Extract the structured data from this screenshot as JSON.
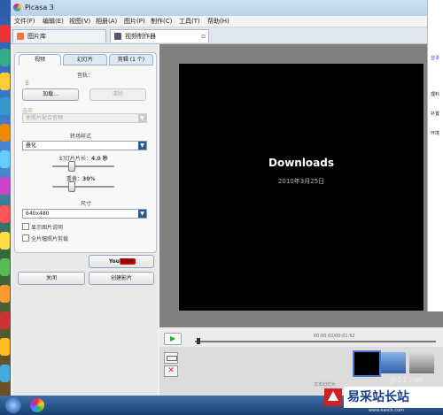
{
  "window": {
    "title": "Picasa 3"
  },
  "menubar": [
    "文件(F)",
    "编辑(E)",
    "视图(V)",
    "相册(A)",
    "图片(P)",
    "制作(C)",
    "工具(T)",
    "帮助(H)"
  ],
  "tabs": [
    {
      "label": "图片库"
    },
    {
      "label": "视频制作器"
    }
  ],
  "panel": {
    "subtabs": [
      "视频",
      "幻灯片",
      "剪辑 (1 个)"
    ],
    "audio_track_label": "音轨：",
    "audio_track_value": "E",
    "load_button": "加载...",
    "clear_button": "清除",
    "options_label": "选项",
    "options_value": "使照片配合音频",
    "transition_label": "转场样式",
    "transition_value": "叠化",
    "slide_duration_label": "幻灯片片长：",
    "slide_duration_value": "4.0 秒",
    "overlap_label": "重叠：",
    "overlap_value": "30%",
    "size_label": "尺寸",
    "size_value": "640x480",
    "show_captions": "显示图片说明",
    "full_frame": "全片幅照片剪裁",
    "youtube_button": "YouTube",
    "close_button": "关闭",
    "create_button": "创建影片"
  },
  "preview": {
    "slide_title": "Downloads",
    "slide_date": "2010年3月25日",
    "time_readout": "00:00:02/00:01:52",
    "caption_hint": "文本幻灯片"
  },
  "right_panel": {
    "items": [
      "登录",
      "理料",
      "补置",
      "环境"
    ]
  },
  "colors": {
    "titlebar": "#cfe0f3",
    "accent_blue": "#2c5a94",
    "stage": "#000000"
  },
  "watermark": {
    "site": "jb51.net",
    "text": "易采站长站",
    "url": "www.easck.com"
  },
  "progress": {
    "slide_duration_fraction": 0.3,
    "overlap_fraction": 0.3,
    "timeline_fraction": 0.02
  }
}
